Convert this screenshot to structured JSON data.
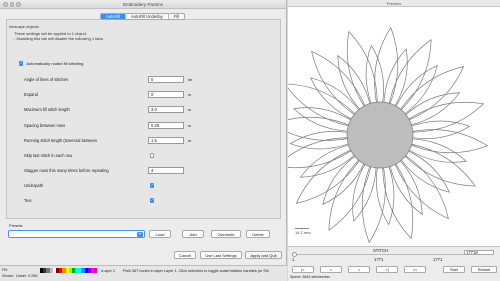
{
  "dialog": {
    "title": "Embroidery Params",
    "tabs": [
      {
        "label": "AutoFill",
        "active": true
      },
      {
        "label": "AutoFill Underlay",
        "active": false
      },
      {
        "label": "Fill",
        "active": false
      }
    ],
    "section_legend": "Inkscape objects",
    "info_line1": "These settings will be applied to 1 object.",
    "info_line2": "- Disabling this tab will disable the following 1 tabs.",
    "auto_label": "Automatically routed fill stitching",
    "auto_checked": true,
    "params": [
      {
        "label": "Angle of lines of stitches",
        "type": "text",
        "value": "0",
        "unit": "de"
      },
      {
        "label": "Expand",
        "type": "text",
        "value": "0",
        "unit": "m"
      },
      {
        "label": "Maximum fill stitch length",
        "type": "text",
        "value": "3.0",
        "unit": "m"
      },
      {
        "label": "Spacing between rows",
        "type": "text",
        "value": "0.25",
        "unit": "m"
      },
      {
        "label": "Running stitch length (traversal between",
        "type": "text",
        "value": "1.5",
        "unit": "m"
      },
      {
        "label": "Skip last stitch in each row",
        "type": "check",
        "checked": false
      },
      {
        "label": "Stagger rows this many times before repeating",
        "type": "text",
        "value": "4",
        "unit": ""
      },
      {
        "label": "Underpath",
        "type": "check",
        "checked": true
      },
      {
        "label": "Ties",
        "type": "check",
        "checked": true
      }
    ],
    "presets_label": "Presets",
    "preset_buttons": [
      "Load",
      "Add",
      "Overwrite",
      "Delete"
    ],
    "footer_buttons": [
      "Cancel",
      "Use Last Settings",
      "Apply and Quit"
    ]
  },
  "statusbar": {
    "fill_label": "Fill:",
    "stroke_label": "Stroke:",
    "stroke_value": "Unset",
    "stroke_width": "0.265",
    "layer": "•Layer 1",
    "message": "Path 367 nodes in layer Layer 1. Click selection to toggle scale/rotation handles (or Shi"
  },
  "simulator": {
    "title": "Preview",
    "scale_label": "14.2 mm",
    "stitch_label": "STITCH",
    "frame_left": "1",
    "frame_mid": "1771",
    "frame_total": "17718",
    "frame_field": "1771",
    "buttons": [
      "|<",
      "<",
      ">",
      ">|",
      "<<",
      "Start",
      "Restart"
    ],
    "speed": "Speed: 3643 stitches/sec"
  },
  "colors": {
    "accent": "#3d8df5",
    "stitch": "#7a7a7a",
    "center": "#bdbdbd"
  }
}
